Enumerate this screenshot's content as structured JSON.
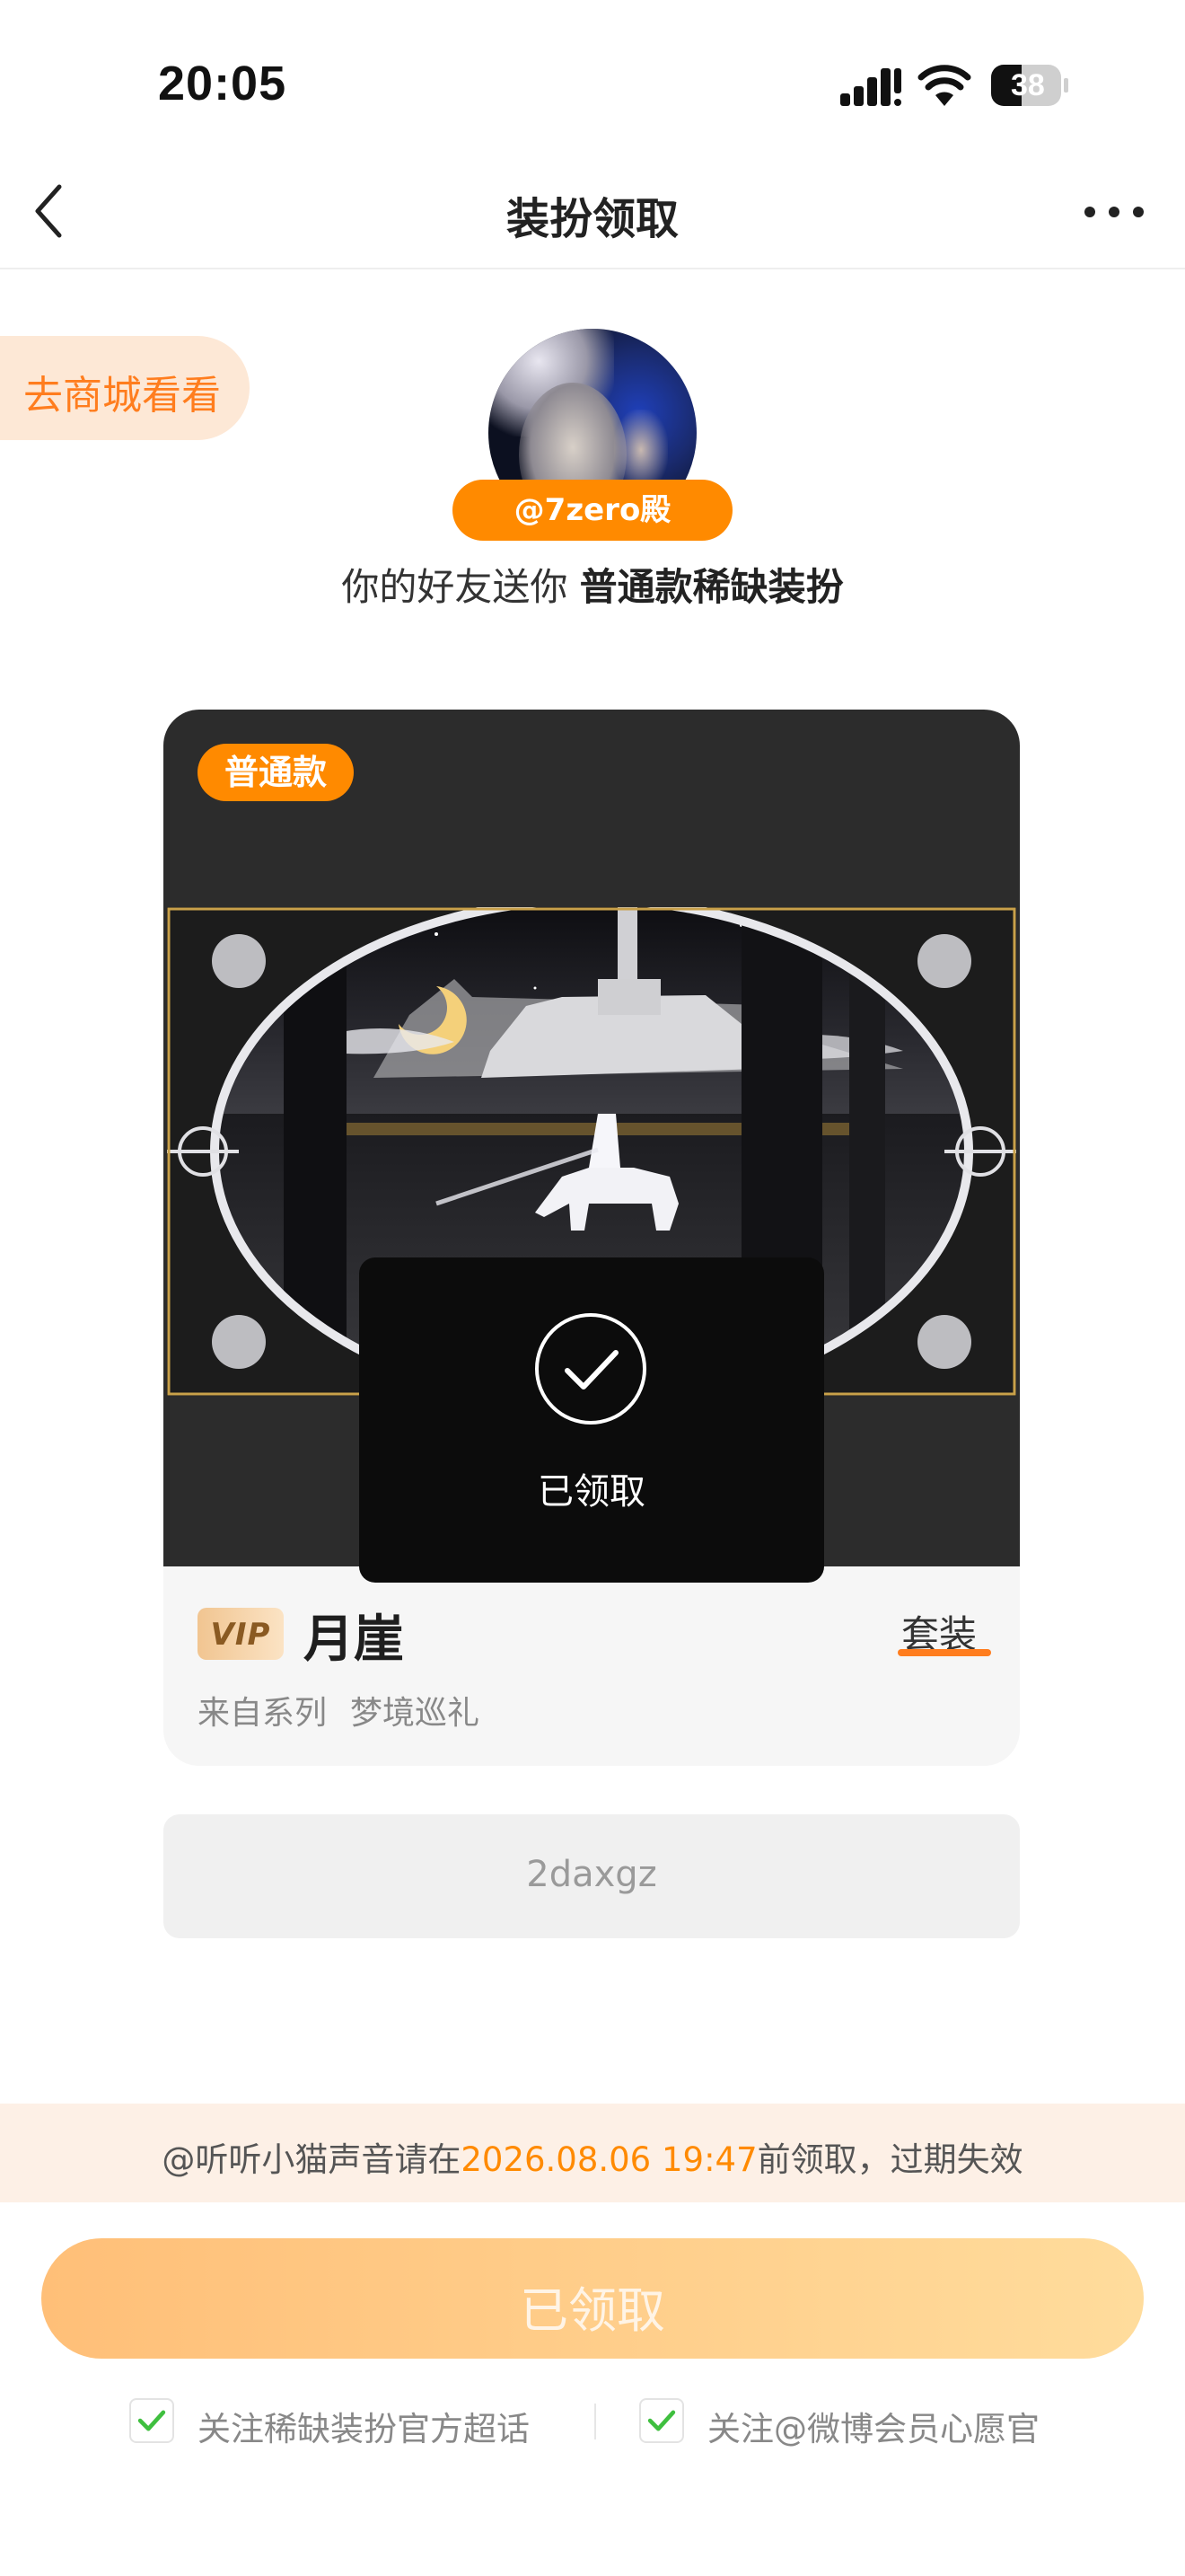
{
  "status_bar": {
    "time": "20:05",
    "battery": "38"
  },
  "nav": {
    "title": "装扮领取"
  },
  "shop_link": {
    "label": "去商城看看"
  },
  "gift": {
    "sender_tag": "@7zero殿",
    "subtitle_prefix": "你的好友送你 ",
    "subtitle_item": "普通款稀缺装扮"
  },
  "card": {
    "badge": "普通款",
    "overlay_status": "已领取",
    "vip_label": "VIP",
    "item_name": "月崖",
    "set_link": "套装",
    "series_label": "来自系列",
    "series_name": "梦境巡礼"
  },
  "code": {
    "value": "2daxgz"
  },
  "notice": {
    "prefix": "@听听小猫声音请在",
    "deadline": "2026.08.06 19:47",
    "suffix": "前领取，过期失效"
  },
  "main_button": {
    "label": "已领取"
  },
  "follow_options": [
    {
      "label": "关注稀缺装扮官方超话",
      "checked": true
    },
    {
      "label": "关注@微博会员心愿官",
      "checked": true
    }
  ],
  "colors": {
    "accent": "#ff8a00",
    "check": "#3fbf3f"
  }
}
